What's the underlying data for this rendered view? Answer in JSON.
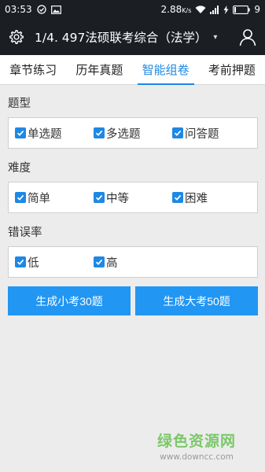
{
  "status": {
    "time": "03:53",
    "speed": "2.88",
    "speed_unit": "K/s",
    "battery": "9"
  },
  "appbar": {
    "title": "1/4. 497法硕联考综合（法学）"
  },
  "tabs": [
    "章节练习",
    "历年真题",
    "智能组卷",
    "考前押题"
  ],
  "active_tab": 2,
  "sections": {
    "type": {
      "label": "题型",
      "options": [
        "单选题",
        "多选题",
        "问答题"
      ],
      "checked": [
        true,
        true,
        true
      ]
    },
    "difficulty": {
      "label": "难度",
      "options": [
        "简单",
        "中等",
        "困难"
      ],
      "checked": [
        true,
        true,
        true
      ]
    },
    "error_rate": {
      "label": "错误率",
      "options": [
        "低",
        "高"
      ],
      "checked": [
        true,
        true
      ]
    }
  },
  "buttons": {
    "small": "生成小考30题",
    "large": "生成大考50题"
  },
  "watermark": {
    "main": "绿色资源网",
    "sub": "www.downcc.com"
  },
  "colors": {
    "accent": "#1e88e5",
    "button": "#2196f3",
    "bar": "#1b1f24"
  }
}
